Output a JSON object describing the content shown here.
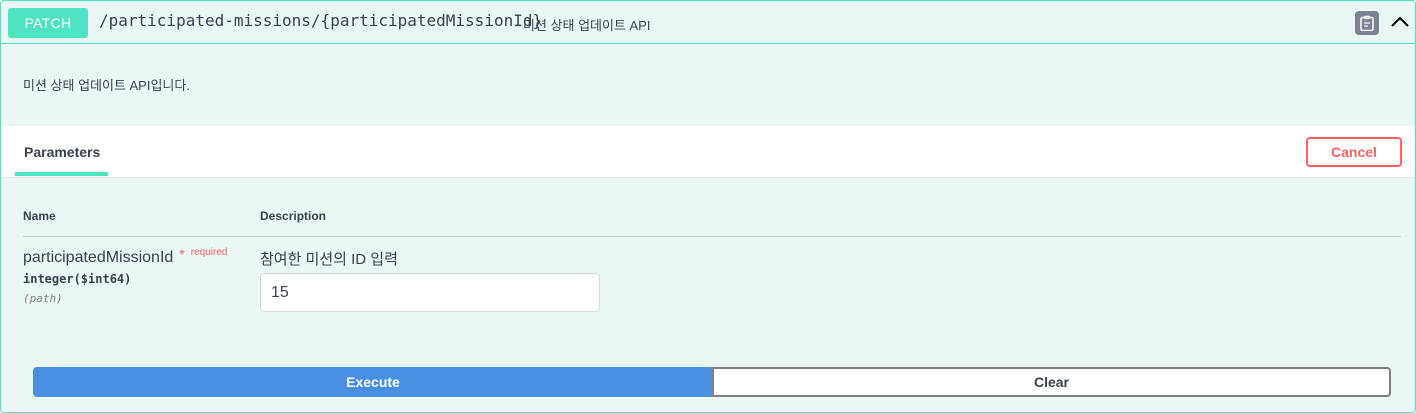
{
  "operation": {
    "method": "PATCH",
    "path": "/participated-missions/{participatedMissionId}",
    "summary": "미션 상태 업데이트 API",
    "description": "미션 상태 업데이트 API입니다.",
    "copy_icon": "clipboard-icon",
    "collapse_icon": "chevron-up-icon"
  },
  "parameters": {
    "tab_label": "Parameters",
    "cancel_label": "Cancel",
    "columns": {
      "name": "Name",
      "description": "Description"
    },
    "items": [
      {
        "name": "participatedMissionId",
        "required_star": "*",
        "required_label": "required",
        "type": "integer($int64)",
        "in": "(path)",
        "description": "참여한 미션의 ID 입력",
        "value": "15"
      }
    ]
  },
  "actions": {
    "execute_label": "Execute",
    "clear_label": "Clear"
  },
  "colors": {
    "method_patch": "#50e3c2",
    "background": "#eaf7f4",
    "execute": "#4990e2",
    "cancel": "#ff6060"
  }
}
